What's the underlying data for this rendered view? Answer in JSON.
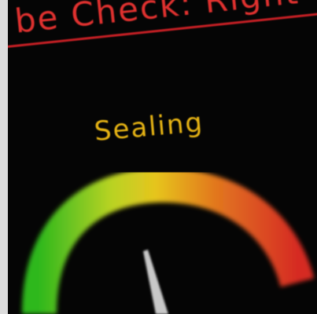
{
  "header": {
    "title": "be Check: Right"
  },
  "gauge": {
    "label": "Sealing",
    "colors": {
      "low": "#3dba25",
      "mid": "#e6c51f",
      "high": "#d62b24",
      "needle": "#c8c8c8"
    }
  }
}
